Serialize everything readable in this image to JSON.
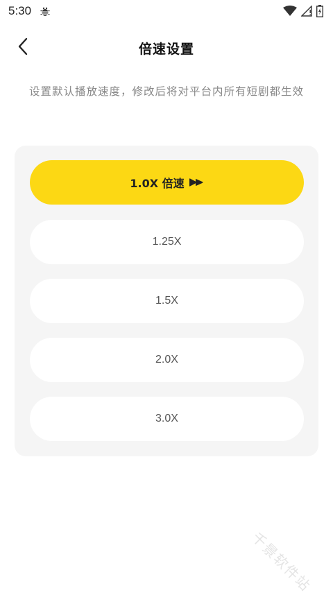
{
  "status_bar": {
    "time": "5:30",
    "icons": [
      "debug-icon",
      "wifi-icon",
      "signal-icon",
      "battery-icon"
    ]
  },
  "nav": {
    "back_icon": "chevron-left-icon",
    "title": "倍速设置"
  },
  "description": "设置默认播放速度，修改后将对平台内所有短剧都生效",
  "speed_options": [
    {
      "label": "1.0X 倍速",
      "selected": true
    },
    {
      "label": "1.25X",
      "selected": false
    },
    {
      "label": "1.5X",
      "selected": false
    },
    {
      "label": "2.0X",
      "selected": false
    },
    {
      "label": "3.0X",
      "selected": false
    }
  ],
  "colors": {
    "accent": "#fcd814",
    "panel_bg": "#f5f5f5",
    "option_bg": "#ffffff",
    "description_text": "#888888"
  },
  "watermark": "千景软件站"
}
